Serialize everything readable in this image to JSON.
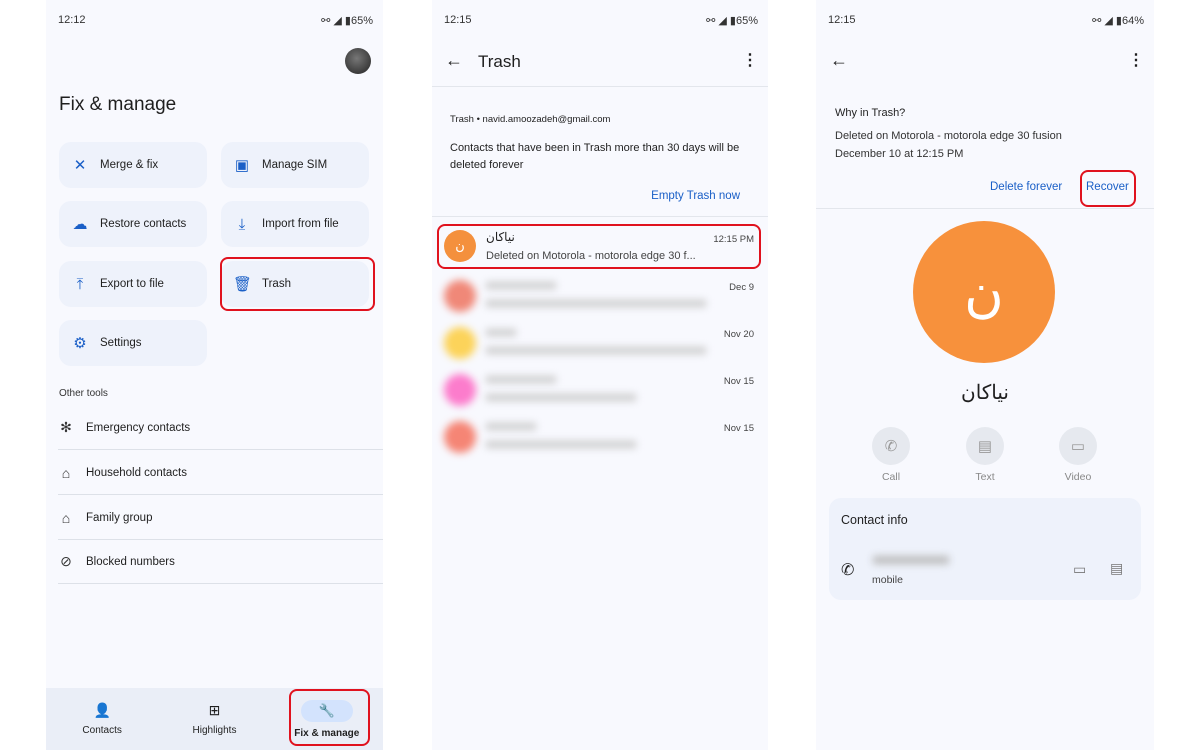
{
  "screen1": {
    "time": "12:12",
    "battery": "65%",
    "title": "Fix & manage",
    "tiles": [
      {
        "label": "Merge & fix",
        "icon": "merge-icon"
      },
      {
        "label": "Manage SIM",
        "icon": "sim-icon"
      },
      {
        "label": "Restore contacts",
        "icon": "cloud-restore-icon"
      },
      {
        "label": "Import from file",
        "icon": "download-icon"
      },
      {
        "label": "Export to file",
        "icon": "upload-icon"
      },
      {
        "label": "Trash",
        "icon": "trash-icon"
      },
      {
        "label": "Settings",
        "icon": "gear-icon"
      }
    ],
    "other_tools_heading": "Other tools",
    "tools": [
      {
        "label": "Emergency contacts"
      },
      {
        "label": "Household contacts"
      },
      {
        "label": "Family group"
      },
      {
        "label": "Blocked numbers"
      }
    ],
    "nav": [
      {
        "label": "Contacts"
      },
      {
        "label": "Highlights"
      },
      {
        "label": "Fix & manage"
      }
    ]
  },
  "screen2": {
    "time": "12:15",
    "battery": "65%",
    "title": "Trash",
    "account": "Trash • navid.amoozadeh@gmail.com",
    "notice": "Contacts that have been in Trash more than 30 days will be deleted forever",
    "empty_label": "Empty Trash now",
    "items": [
      {
        "name": "نیاکان",
        "initial": "ن",
        "subtitle": "Deleted on Motorola - motorola edge 30 f...",
        "time": "12:15 PM",
        "color": "#f4903d"
      },
      {
        "time": "Dec 9",
        "color": "#f08878"
      },
      {
        "time": "Nov 20",
        "color": "#fcd35a"
      },
      {
        "time": "Nov 15",
        "color": "#fc7ccc"
      },
      {
        "time": "Nov 15",
        "color": "#f58575"
      }
    ]
  },
  "screen3": {
    "time": "12:15",
    "battery": "64%",
    "why_heading": "Why in Trash?",
    "why_line1": "Deleted on Motorola - motorola edge 30 fusion",
    "why_line2": "December 10 at 12:15 PM",
    "delete_label": "Delete forever",
    "recover_label": "Recover",
    "initial": "ن",
    "name": "نیاکان",
    "avatar_color": "#f7913c",
    "actions": [
      {
        "label": "Call"
      },
      {
        "label": "Text"
      },
      {
        "label": "Video"
      }
    ],
    "contact_info_heading": "Contact info",
    "phone_type": "mobile"
  },
  "colors": {
    "accent": "#1a5fc7",
    "highlight": "#e0121e"
  }
}
